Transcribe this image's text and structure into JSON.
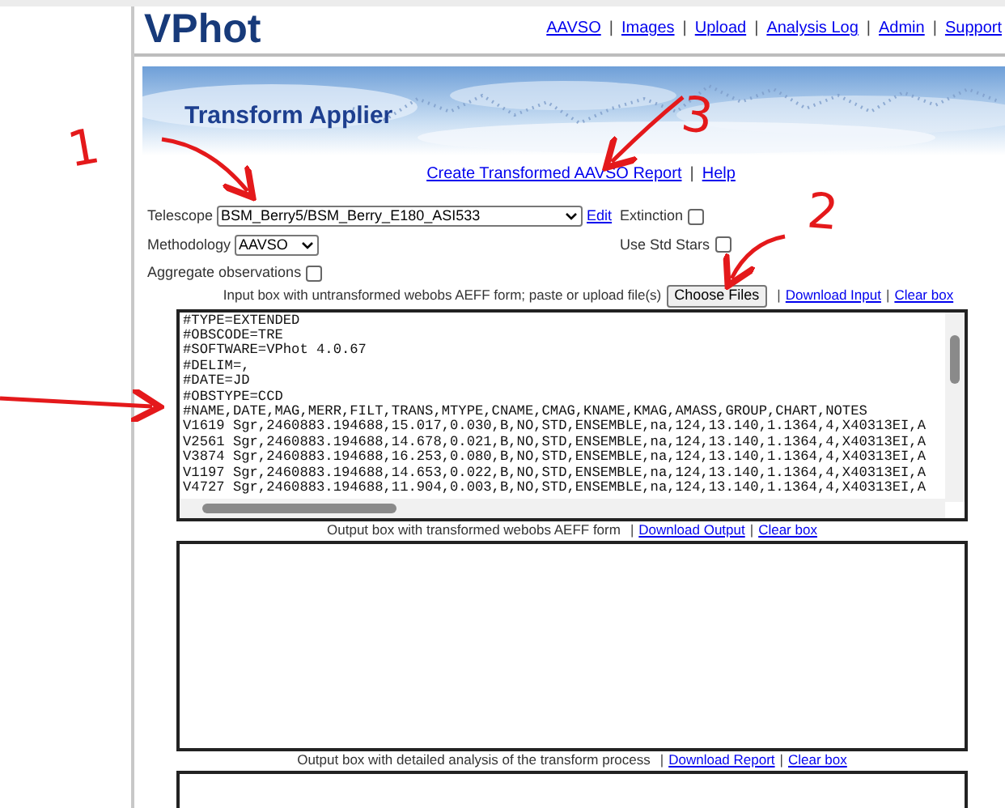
{
  "header": {
    "logo": "VPhot",
    "nav": [
      {
        "label": "AAVSO"
      },
      {
        "separator": "|",
        "label": "Images"
      },
      {
        "separator": "|",
        "label": "Upload"
      },
      {
        "separator": "|",
        "label": "Analysis Log"
      },
      {
        "separator": "|",
        "label": "Admin"
      },
      {
        "separator": "|",
        "label": "Support"
      }
    ]
  },
  "banner": {
    "title": "Transform Applier",
    "kind": "picture"
  },
  "actions": [
    {
      "label": "Create Transformed AAVSO Report"
    },
    {
      "separator": "|",
      "label": "Help"
    }
  ],
  "form": {
    "telescope": {
      "label": "Telescope",
      "value": "BSM_Berry5/BSM_Berry_E180_ASI533",
      "edit": "Edit"
    },
    "methodology": {
      "label": "Methodology",
      "value": "AAVSO"
    },
    "options": [
      {
        "label": "Extinction",
        "checked": false
      },
      {
        "label": "Use Std Stars",
        "checked": false
      },
      {
        "label": "Aggregate observations",
        "checked": false
      }
    ]
  },
  "input": {
    "caption": "Input box with untransformed webobs AEFF form; paste or upload file(s)",
    "button": "Choose Files",
    "links": [
      {
        "separator": "|",
        "label": "Download Input"
      },
      {
        "separator": "|",
        "label": "Clear box"
      }
    ],
    "lines": [
      "#TYPE=EXTENDED",
      "#OBSCODE=TRE",
      "#SOFTWARE=VPhot 4.0.67",
      "#DELIM=,",
      "#DATE=JD",
      "#OBSTYPE=CCD",
      "#NAME,DATE,MAG,MERR,FILT,TRANS,MTYPE,CNAME,CMAG,KNAME,KMAG,AMASS,GROUP,CHART,NOTES",
      "V1619 Sgr,2460883.194688,15.017,0.030,B,NO,STD,ENSEMBLE,na,124,13.140,1.1364,4,X40313EI,A",
      "V2561 Sgr,2460883.194688,14.678,0.021,B,NO,STD,ENSEMBLE,na,124,13.140,1.1364,4,X40313EI,A",
      "V3874 Sgr,2460883.194688,16.253,0.080,B,NO,STD,ENSEMBLE,na,124,13.140,1.1364,4,X40313EI,A",
      "V1197 Sgr,2460883.194688,14.653,0.022,B,NO,STD,ENSEMBLE,na,124,13.140,1.1364,4,X40313EI,A",
      "V4727 Sgr,2460883.194688,11.904,0.003,B,NO,STD,ENSEMBLE,na,124,13.140,1.1364,4,X40313EI,A"
    ]
  },
  "output": {
    "caption": "Output box with transformed webobs AEFF form",
    "links": [
      {
        "separator": "|",
        "label": "Download Output"
      },
      {
        "separator": "|",
        "label": "Clear box"
      }
    ]
  },
  "report": {
    "caption": "Output box with detailed analysis of the transform process",
    "links": [
      {
        "separator": "|",
        "label": "Download Report"
      },
      {
        "separator": "|",
        "label": "Clear box"
      }
    ]
  },
  "annotations": [
    "1",
    "3",
    "2"
  ]
}
